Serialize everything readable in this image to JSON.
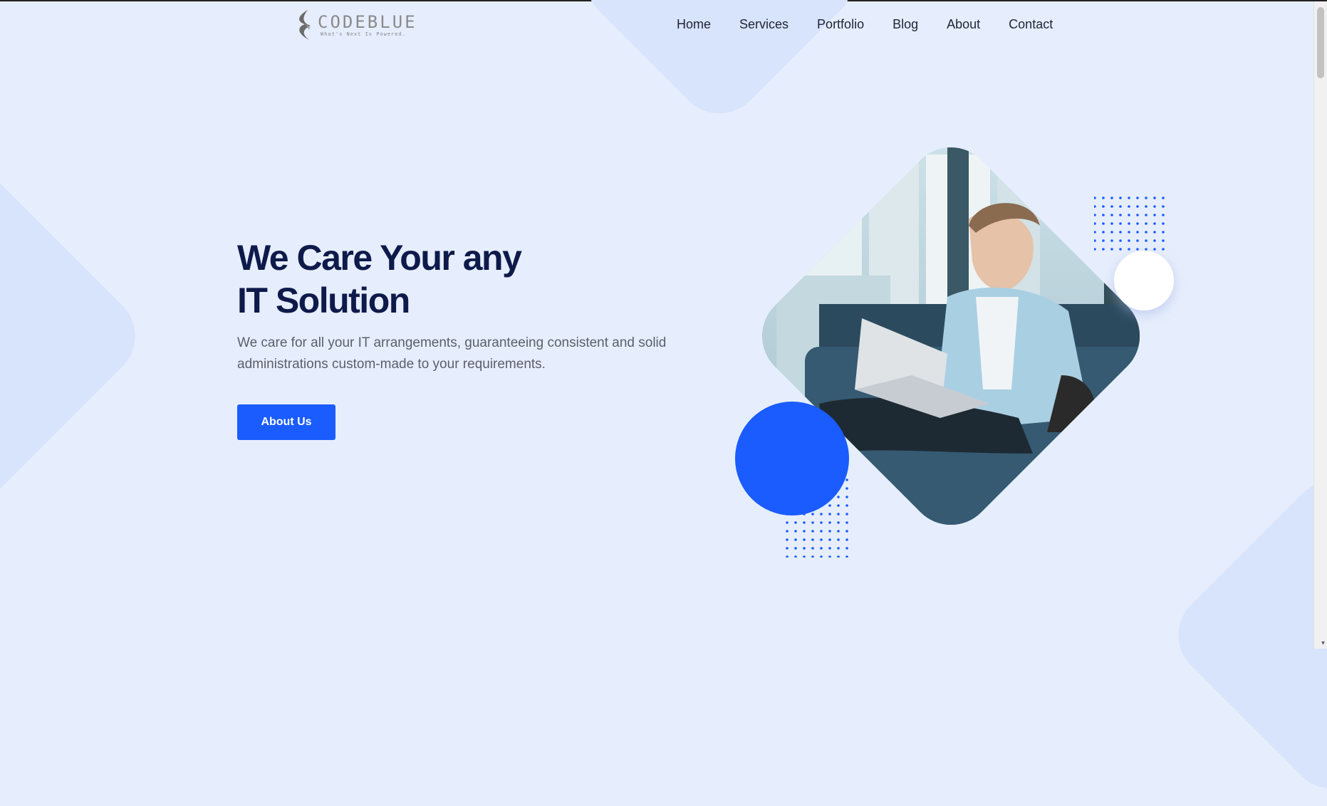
{
  "logo": {
    "name": "CODEBLUE",
    "tagline": "What's Next Is Powered."
  },
  "nav": [
    "Home",
    "Services",
    "Portfolio",
    "Blog",
    "About",
    "Contact"
  ],
  "hero": {
    "title_line1": "We Care Your any",
    "title_line2": "IT Solution",
    "description": "We care for all your IT arrangements, guaranteeing consistent and solid administrations custom-made to your requirements.",
    "cta_label": "About Us"
  },
  "colors": {
    "primary": "#1a5cff",
    "heading": "#0e1a4a",
    "background": "#e6eefd",
    "shape": "#d8e3fc"
  },
  "icons": {
    "logo_mark": "codeblue-swoosh-icon",
    "hero_image": "man-with-laptop-photo"
  }
}
